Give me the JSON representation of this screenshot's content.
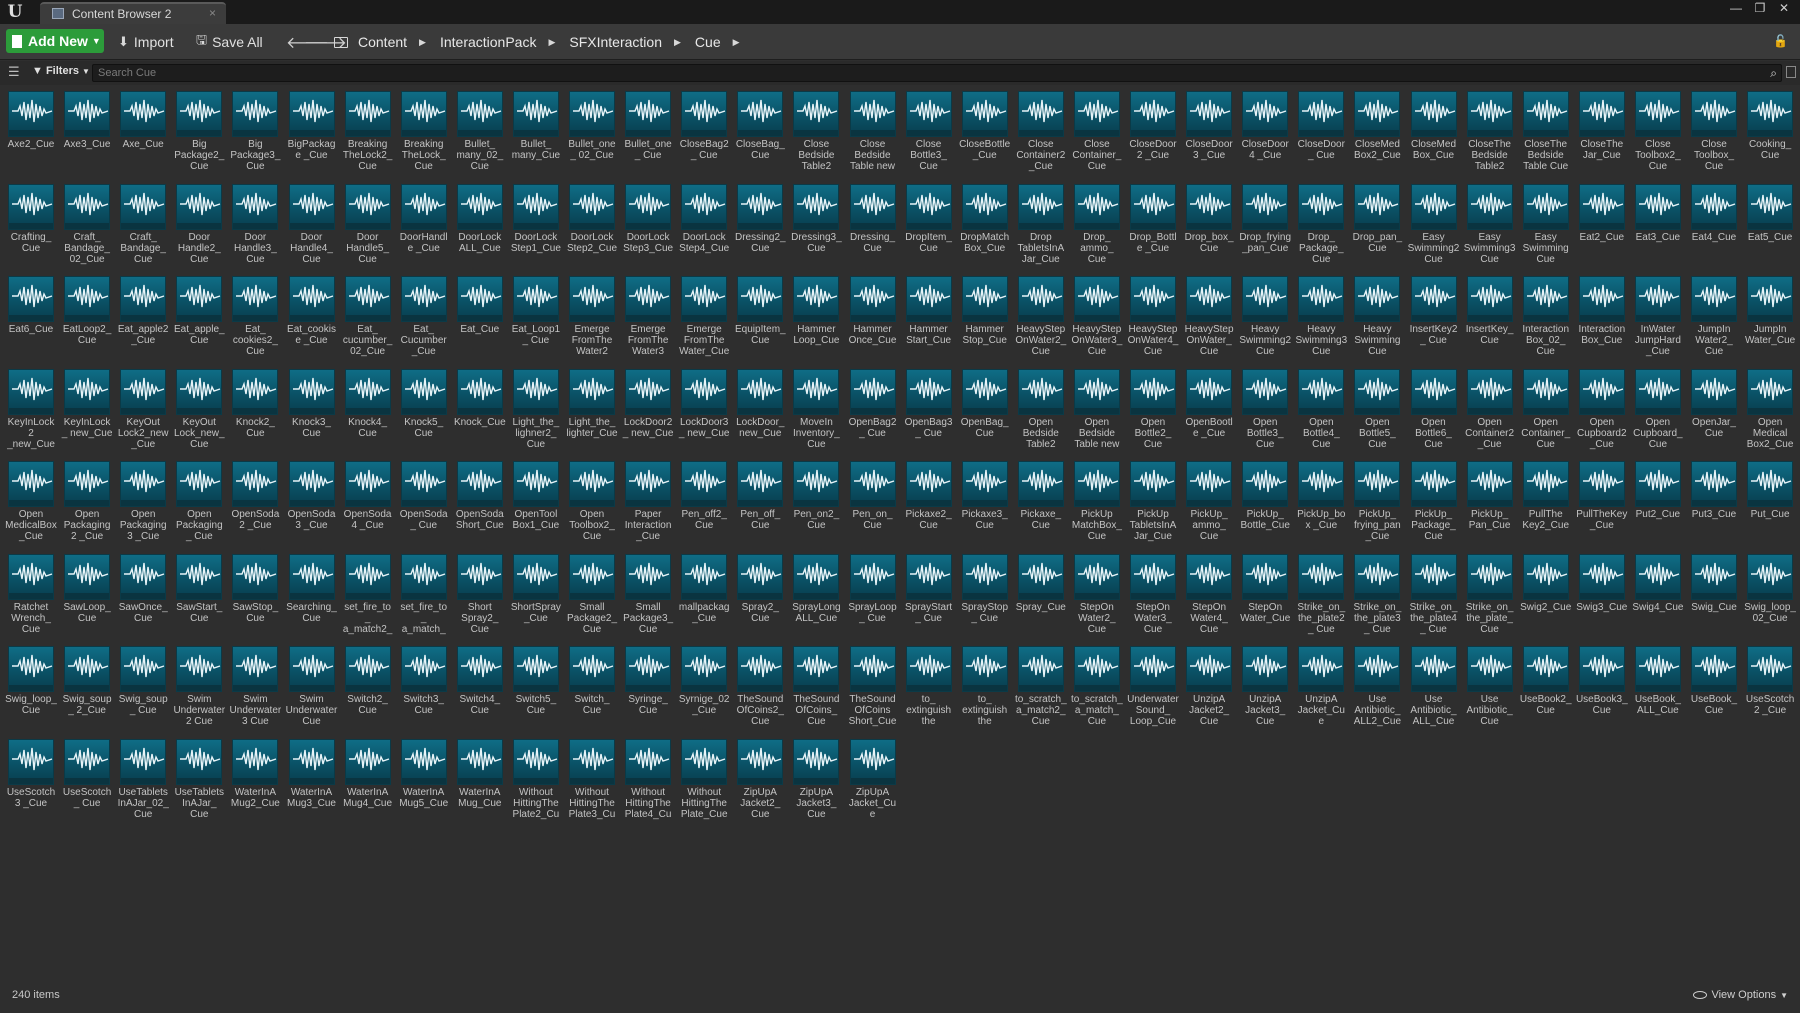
{
  "app": {
    "logo": "U"
  },
  "tab": {
    "title": "Content Browser 2",
    "close": "×"
  },
  "window_buttons": [
    "—",
    "❐",
    "✕"
  ],
  "toolbar": {
    "add_new": "Add New",
    "import": "Import",
    "save_all": "Save All"
  },
  "breadcrumb": [
    "Content",
    "InteractionPack",
    "SFXInteraction",
    "Cue"
  ],
  "filters": {
    "label": "Filters"
  },
  "search": {
    "placeholder": "Search Cue"
  },
  "status": {
    "item_count": "240 items",
    "view_options": "View Options"
  },
  "colors": {
    "accent_green": "#2c9c3a",
    "thumb": "#0f6d86"
  },
  "assets": [
    "Axe2_Cue",
    "Axe3_Cue",
    "Axe_Cue",
    "Big Package2_ Cue",
    "Big Package3_ Cue",
    "BigPackage _Cue",
    "Breaking TheLock2_ Cue",
    "Breaking TheLock_ Cue",
    "Bullet_ many_02_ Cue",
    "Bullet_ many_Cue",
    "Bullet_one_ 02_Cue",
    "Bullet_one_ Cue",
    "CloseBag2_ Cue",
    "CloseBag_ Cue",
    "Close Bedside Table2",
    "Close Bedside Table new",
    "Close Bottle3_ Cue",
    "CloseBottle _Cue",
    "Close Container2 _Cue",
    "Close Container_ Cue",
    "CloseDoor2 _Cue",
    "CloseDoor3 _Cue",
    "CloseDoor4 _Cue",
    "CloseDoor_ Cue",
    "CloseMed Box2_Cue",
    "CloseMed Box_Cue",
    "CloseThe Bedside Table2",
    "CloseThe Bedside Table Cue",
    "CloseThe Jar_Cue",
    "Close Toolbox2_ Cue",
    "Close Toolbox_ Cue",
    "Cooking_ Cue",
    "Crafting_ Cue",
    "Craft_ Bandage_ 02_Cue",
    "Craft_ Bandage_ Cue",
    "Door Handle2_ Cue",
    "Door Handle3_ Cue",
    "Door Handle4_ Cue",
    "Door Handle5_ Cue",
    "DoorHandle _Cue",
    "DoorLock ALL_Cue",
    "DoorLock Step1_Cue",
    "DoorLock Step2_Cue",
    "DoorLock Step3_Cue",
    "DoorLock Step4_Cue",
    "Dressing2_ Cue",
    "Dressing3_ Cue",
    "Dressing_ Cue",
    "DropItem_ Cue",
    "DropMatch Box_Cue",
    "Drop TabletsInA Jar_Cue",
    "Drop_ ammo_ Cue",
    "Drop_Bottle _Cue",
    "Drop_box_ Cue",
    "Drop_frying _pan_Cue",
    "Drop_ Package_ Cue",
    "Drop_pan_ Cue",
    "Easy Swimming2 Cue",
    "Easy Swimming3 Cue",
    "Easy Swimming Cue",
    "Eat2_Cue",
    "Eat3_Cue",
    "Eat4_Cue",
    "Eat5_Cue",
    "Eat6_Cue",
    "EatLoop2_ Cue",
    "Eat_apple2 _Cue",
    "Eat_apple_ Cue",
    "Eat_ cookies2_ Cue",
    "Eat_cookise _Cue",
    "Eat_ cucumber_ 02_Cue",
    "Eat_ Cucumber _Cue",
    "Eat_Cue",
    "Eat_Loop1_ Cue",
    "Emerge FromThe Water2",
    "Emerge FromThe Water3",
    "Emerge FromThe Water_Cue",
    "EquipItem_ Cue",
    "Hammer Loop_Cue",
    "Hammer Once_Cue",
    "Hammer Start_Cue",
    "Hammer Stop_Cue",
    "HeavyStep OnWater2_ Cue",
    "HeavyStep OnWater3_ Cue",
    "HeavyStep OnWater4_ Cue",
    "HeavyStep OnWater_ Cue",
    "Heavy Swimming2 Cue",
    "Heavy Swimming3 Cue",
    "Heavy Swimming Cue",
    "InsertKey2_ Cue",
    "InsertKey_ Cue",
    "Interaction Box_02_ Cue",
    "Interaction Box_Cue",
    "InWater JumpHard _Cue",
    "JumpIn Water2_ Cue",
    "JumpIn Water_Cue",
    "KeyInLock2 _new_Cue",
    "KeyInLock_ new_Cue",
    "KeyOut Lock2_new _Cue",
    "KeyOut Lock_new_ Cue",
    "Knock2_ Cue",
    "Knock3_ Cue",
    "Knock4_ Cue",
    "Knock5_ Cue",
    "Knock_Cue",
    "Light_the_ lighner2_ Cue",
    "Light_the_ lighter_Cue",
    "LockDoor2_ new_Cue",
    "LockDoor3_ new_Cue",
    "LockDoor_ new_Cue",
    "MoveIn Inventory_ Cue",
    "OpenBag2_ Cue",
    "OpenBag3_ Cue",
    "OpenBag_ Cue",
    "Open Bedside Table2",
    "Open Bedside Table new",
    "Open Bottle2_ Cue",
    "OpenBootle _Cue",
    "Open Bottle3_ Cue",
    "Open Bottle4_ Cue",
    "Open Bottle5_ Cue",
    "Open Bottle6_ Cue",
    "Open Container2 _Cue",
    "Open Container_ Cue",
    "Open Cupboard2 _Cue",
    "Open Cupboard_ Cue",
    "OpenJar_ Cue",
    "Open Medical Box2_Cue",
    "Open MedicalBox _Cue",
    "Open Packaging2 _Cue",
    "Open Packaging3 _Cue",
    "Open Packaging_ Cue",
    "OpenSoda2 _Cue",
    "OpenSoda3 _Cue",
    "OpenSoda4 _Cue",
    "OpenSoda_ Cue",
    "OpenSoda Short_Cue",
    "OpenTool Box1_Cue",
    "Open Toolbox2_ Cue",
    "Paper Interaction _Cue",
    "Pen_off2_ Cue",
    "Pen_off_ Cue",
    "Pen_on2_ Cue",
    "Pen_on_ Cue",
    "Pickaxe2_ Cue",
    "Pickaxe3_ Cue",
    "Pickaxe_ Cue",
    "PickUp MatchBox_ Cue",
    "PickUp TabletsInA Jar_Cue",
    "PickUp_ ammo_ Cue",
    "PickUp_ Bottle_Cue",
    "PickUp_box _Cue",
    "PickUp_ frying_pan _Cue",
    "PickUp_ Package_ Cue",
    "PickUp_ Pan_Cue",
    "PullThe Key2_Cue",
    "PullTheKey _Cue",
    "Put2_Cue",
    "Put3_Cue",
    "Put_Cue",
    "Ratchet Wrench_ Cue",
    "SawLoop_ Cue",
    "SawOnce_ Cue",
    "SawStart_ Cue",
    "SawStop_ Cue",
    "Searching_ Cue",
    "set_fire_to_ a_match2_ Cue",
    "set_fire_to_ a_match_ Cue",
    "Short Spray2_ Cue",
    "ShortSpray _Cue",
    "Small Package2_ Cue",
    "Small Package3_ Cue",
    "mallpackag _Cue",
    "Spray2_ Cue",
    "SprayLong ALL_Cue",
    "SprayLoop_ Cue",
    "SprayStart_ Cue",
    "SprayStop_ Cue",
    "Spray_Cue",
    "StepOn Water2_ Cue",
    "StepOn Water3_ Cue",
    "StepOn Water4_ Cue",
    "StepOn Water_Cue",
    "Strike_on_ the_plate2_ Cue",
    "Strike_on_ the_plate3_ Cue",
    "Strike_on_ the_plate4_ Cue",
    "Strike_on_ the_plate_ Cue",
    "Swig2_Cue",
    "Swig3_Cue",
    "Swig4_Cue",
    "Swig_Cue",
    "Swig_loop_ 02_Cue",
    "Swig_loop_ Cue",
    "Swig_soup_ 2_Cue",
    "Swig_soup_ Cue",
    "Swim Underwater2 Cue",
    "Swim Underwater3 Cue",
    "Swim Underwater Cue",
    "Switch2_ Cue",
    "Switch3_ Cue",
    "Switch4_ Cue",
    "Switch5_ Cue",
    "Switch_ Cue",
    "Syringe_ Cue",
    "Syrnige_02 _Cue",
    "TheSound OfCoins2_ Cue",
    "TheSound OfCoins_ Cue",
    "TheSound OfCoins Short_Cue",
    "to_ extinguish the",
    "to_ extinguish the",
    "to_scratch_ a_match2_ Cue",
    "to_scratch_ a_match_ Cue",
    "Underwater Sound_ Loop_Cue",
    "UnzipA Jacket2_ Cue",
    "UnzipA Jacket3_ Cue",
    "UnzipA Jacket_Cue",
    "Use Antibiotic_ ALL2_Cue",
    "Use Antibiotic_ ALL_Cue",
    "Use Antibiotic_ Cue",
    "UseBook2_ Cue",
    "UseBook3_ Cue",
    "UseBook_ ALL_Cue",
    "UseBook_ Cue",
    "UseScotch2 _Cue",
    "UseScotch3 _Cue",
    "UseScotch_ Cue",
    "UseTablets InAJar_02_ Cue",
    "UseTablets InAJar_ Cue",
    "WaterInA Mug2_Cue",
    "WaterInA Mug3_Cue",
    "WaterInA Mug4_Cue",
    "WaterInA Mug5_Cue",
    "WaterInA Mug_Cue",
    "Without HittingThe Plate2_Cue",
    "Without HittingThe Plate3_Cue",
    "Without HittingThe Plate4_Cue",
    "Without HittingThe Plate_Cue",
    "ZipUpA Jacket2_ Cue",
    "ZipUpA Jacket3_ Cue",
    "ZipUpA Jacket_Cue"
  ]
}
